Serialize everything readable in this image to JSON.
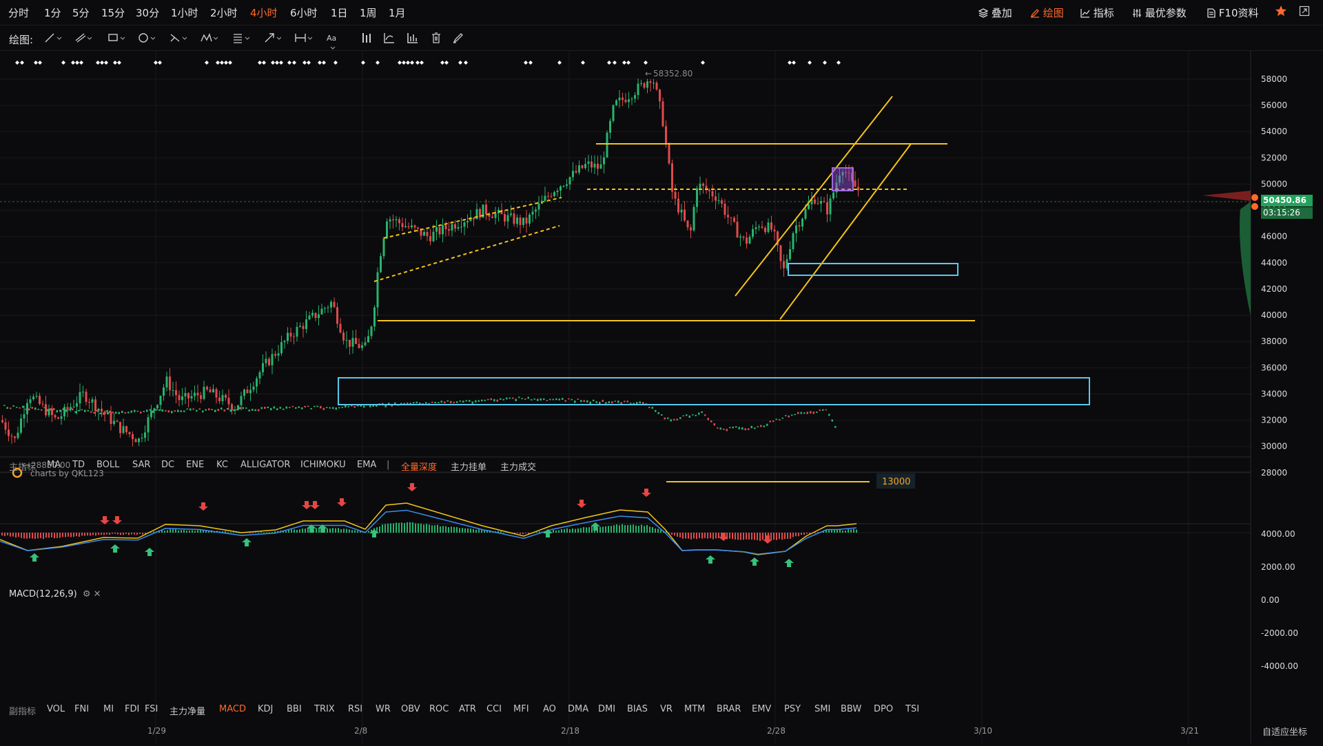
{
  "timeframes": [
    "分时",
    "1分",
    "5分",
    "15分",
    "30分",
    "1小时",
    "2小时",
    "4小时",
    "6小时",
    "1日",
    "1周",
    "1月"
  ],
  "active_timeframe": "4小时",
  "top_right": {
    "overlay": "叠加",
    "draw": "绘图",
    "indicator": "指标",
    "best_params": "最优参数",
    "f10": "F10资料"
  },
  "toolbar": {
    "label": "绘图:",
    "text_tool": "Aa"
  },
  "price_axis": [
    "58000",
    "56000",
    "54000",
    "52000",
    "50000",
    "48000",
    "46000",
    "44000",
    "42000",
    "40000",
    "38000",
    "36000",
    "34000",
    "32000",
    "30000",
    "28000"
  ],
  "current_price": "50450.86",
  "countdown": "03:15:26",
  "high_label": "58352.80",
  "low_label": "28850.00",
  "level_label": "13000",
  "watermark": "charts by QKL123",
  "main_indicators": {
    "label": "主指标",
    "items": [
      "MA",
      "TD",
      "BOLL",
      "SAR",
      "DC",
      "ENE",
      "KC",
      "ALLIGATOR",
      "ICHIMOKU",
      "EMA"
    ],
    "depth_items": [
      "全量深度",
      "主力挂单",
      "主力成交"
    ],
    "active": "全量深度"
  },
  "macd": {
    "label": "MACD(12,26,9)",
    "axis": [
      "4000.00",
      "2000.00",
      "0.00",
      "-2000.00",
      "-4000.00"
    ]
  },
  "sub_indicators": {
    "label": "副指标",
    "items": [
      "VOL",
      "FNI",
      "MI",
      "FDI",
      "FSI",
      "主力净量",
      "MACD",
      "KDJ",
      "BBI",
      "TRIX",
      "RSI",
      "WR",
      "OBV",
      "ROC",
      "ATR",
      "CCI",
      "MFI",
      "AO",
      "DMA",
      "DMI",
      "BIAS",
      "VR",
      "MTM",
      "BRAR",
      "EMV",
      "PSY",
      "SMI",
      "BBW",
      "DPO",
      "TSI"
    ],
    "active": "MACD"
  },
  "date_axis": [
    "1/29",
    "2/8",
    "2/18",
    "2/28",
    "3/10",
    "3/21"
  ],
  "corner_label": "自适应坐标",
  "colors": {
    "up": "#27b46e",
    "down": "#e04b4b",
    "accent": "#ff6a2a",
    "trend": "#f5c518",
    "zone": "#5bc8f0",
    "bg": "#0b0b0d"
  }
}
